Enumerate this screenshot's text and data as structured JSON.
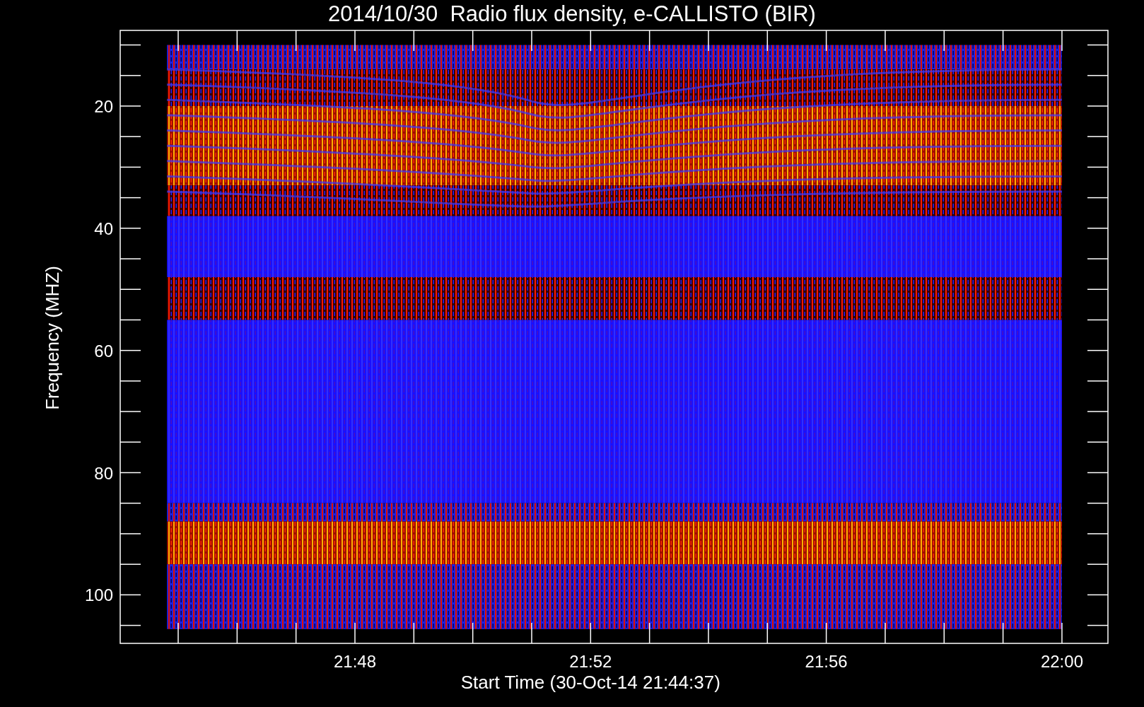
{
  "title": "2014/10/30  Radio flux density, e-CALLISTO (BIR)",
  "y_axis": {
    "label": "Frequency (MHZ)",
    "ticks": [
      "20",
      "40",
      "60",
      "80",
      "100"
    ]
  },
  "x_axis": {
    "label": "Start Time (30-Oct-14 21:44:37)",
    "ticks": [
      "21:48",
      "21:52",
      "21:56",
      "22:00"
    ]
  }
}
